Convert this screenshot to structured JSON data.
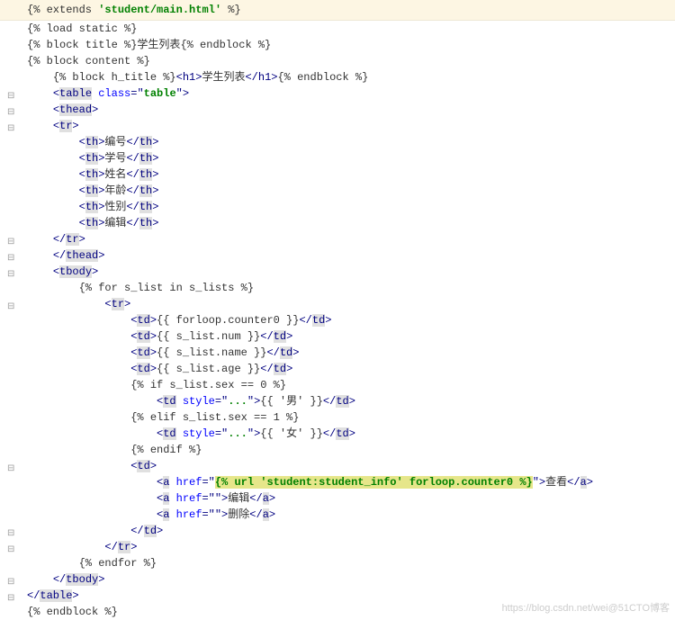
{
  "lines": [
    {
      "indent": 0,
      "type": "header",
      "seg": [
        [
          "tmpl-tag",
          "{% extends "
        ],
        [
          "tmpl-str",
          "'student/main.html'"
        ],
        [
          "tmpl-tag",
          " %}"
        ]
      ]
    },
    {
      "indent": 0,
      "seg": [
        [
          "tmpl-tag",
          "{% load static %}"
        ]
      ]
    },
    {
      "indent": 0,
      "seg": [
        [
          "tmpl-tag",
          "{% block title %}"
        ],
        [
          "text",
          "学生列表"
        ],
        [
          "tmpl-tag",
          "{% endblock %}"
        ]
      ]
    },
    {
      "indent": 0,
      "seg": [
        [
          "tmpl-tag",
          "{% block content %}"
        ]
      ]
    },
    {
      "indent": 1,
      "seg": [
        [
          "tmpl-tag",
          "{% block h_title %}"
        ],
        [
          "tag",
          "<"
        ],
        [
          "tag-name",
          "h1"
        ],
        [
          "tag",
          ">"
        ],
        [
          "text",
          "学生列表"
        ],
        [
          "tag",
          "</"
        ],
        [
          "tag-name",
          "h1"
        ],
        [
          "tag",
          ">"
        ],
        [
          "tmpl-tag",
          "{% endblock %}"
        ]
      ]
    },
    {
      "indent": 1,
      "fold": "-",
      "seg": [
        [
          "tag",
          "<"
        ],
        [
          "tag-name hl-grey",
          "table"
        ],
        [
          "text",
          " "
        ],
        [
          "attr-name",
          "class"
        ],
        [
          "tag",
          "=\""
        ],
        [
          "attr-val",
          "table"
        ],
        [
          "tag",
          "\">"
        ]
      ]
    },
    {
      "indent": 1,
      "fold": "-",
      "seg": [
        [
          "tag",
          "<"
        ],
        [
          "tag-name hl-grey",
          "thead"
        ],
        [
          "tag",
          ">"
        ]
      ]
    },
    {
      "indent": 1,
      "fold": "-",
      "seg": [
        [
          "tag",
          "<"
        ],
        [
          "tag-name hl-grey",
          "tr"
        ],
        [
          "tag",
          ">"
        ]
      ]
    },
    {
      "indent": 2,
      "seg": [
        [
          "tag",
          "<"
        ],
        [
          "tag-name hl-grey",
          "th"
        ],
        [
          "tag",
          ">"
        ],
        [
          "text",
          "编号"
        ],
        [
          "tag",
          "</"
        ],
        [
          "tag-name hl-grey",
          "th"
        ],
        [
          "tag",
          ">"
        ]
      ]
    },
    {
      "indent": 2,
      "seg": [
        [
          "tag",
          "<"
        ],
        [
          "tag-name hl-grey",
          "th"
        ],
        [
          "tag",
          ">"
        ],
        [
          "text",
          "学号"
        ],
        [
          "tag",
          "</"
        ],
        [
          "tag-name hl-grey",
          "th"
        ],
        [
          "tag",
          ">"
        ]
      ]
    },
    {
      "indent": 2,
      "seg": [
        [
          "tag",
          "<"
        ],
        [
          "tag-name hl-grey",
          "th"
        ],
        [
          "tag",
          ">"
        ],
        [
          "text",
          "姓名"
        ],
        [
          "tag",
          "</"
        ],
        [
          "tag-name hl-grey",
          "th"
        ],
        [
          "tag",
          ">"
        ]
      ]
    },
    {
      "indent": 2,
      "seg": [
        [
          "tag",
          "<"
        ],
        [
          "tag-name hl-grey",
          "th"
        ],
        [
          "tag",
          ">"
        ],
        [
          "text",
          "年龄"
        ],
        [
          "tag",
          "</"
        ],
        [
          "tag-name hl-grey",
          "th"
        ],
        [
          "tag",
          ">"
        ]
      ]
    },
    {
      "indent": 2,
      "seg": [
        [
          "tag",
          "<"
        ],
        [
          "tag-name hl-grey",
          "th"
        ],
        [
          "tag",
          ">"
        ],
        [
          "text",
          "性别"
        ],
        [
          "tag",
          "</"
        ],
        [
          "tag-name hl-grey",
          "th"
        ],
        [
          "tag",
          ">"
        ]
      ]
    },
    {
      "indent": 2,
      "seg": [
        [
          "tag",
          "<"
        ],
        [
          "tag-name hl-grey",
          "th"
        ],
        [
          "tag",
          ">"
        ],
        [
          "text",
          "编辑"
        ],
        [
          "tag",
          "</"
        ],
        [
          "tag-name hl-grey",
          "th"
        ],
        [
          "tag",
          ">"
        ]
      ]
    },
    {
      "indent": 1,
      "fold": "-",
      "seg": [
        [
          "tag",
          "</"
        ],
        [
          "tag-name hl-grey",
          "tr"
        ],
        [
          "tag",
          ">"
        ]
      ]
    },
    {
      "indent": 1,
      "fold": "-",
      "seg": [
        [
          "tag",
          "</"
        ],
        [
          "tag-name hl-grey",
          "thead"
        ],
        [
          "tag",
          ">"
        ]
      ]
    },
    {
      "indent": 1,
      "fold": "-",
      "seg": [
        [
          "tag",
          "<"
        ],
        [
          "tag-name hl-grey",
          "tbody"
        ],
        [
          "tag",
          ">"
        ]
      ]
    },
    {
      "indent": 2,
      "seg": [
        [
          "tmpl-tag",
          "{% for s_list in s_lists %}"
        ]
      ]
    },
    {
      "indent": 3,
      "fold": "-",
      "seg": [
        [
          "tag",
          "<"
        ],
        [
          "tag-name hl-grey",
          "tr"
        ],
        [
          "tag",
          ">"
        ]
      ]
    },
    {
      "indent": 4,
      "seg": [
        [
          "tag",
          "<"
        ],
        [
          "tag-name hl-grey",
          "td"
        ],
        [
          "tag",
          ">"
        ],
        [
          "tmpl-var",
          "{{ forloop.counter0 }}"
        ],
        [
          "tag",
          "</"
        ],
        [
          "tag-name hl-grey",
          "td"
        ],
        [
          "tag",
          ">"
        ]
      ]
    },
    {
      "indent": 4,
      "seg": [
        [
          "tag",
          "<"
        ],
        [
          "tag-name hl-grey",
          "td"
        ],
        [
          "tag",
          ">"
        ],
        [
          "tmpl-var",
          "{{ s_list.num }}"
        ],
        [
          "tag",
          "</"
        ],
        [
          "tag-name hl-grey",
          "td"
        ],
        [
          "tag",
          ">"
        ]
      ]
    },
    {
      "indent": 4,
      "seg": [
        [
          "tag",
          "<"
        ],
        [
          "tag-name hl-grey",
          "td"
        ],
        [
          "tag",
          ">"
        ],
        [
          "tmpl-var",
          "{{ s_list.name }}"
        ],
        [
          "tag",
          "</"
        ],
        [
          "tag-name hl-grey",
          "td"
        ],
        [
          "tag",
          ">"
        ]
      ]
    },
    {
      "indent": 4,
      "seg": [
        [
          "tag",
          "<"
        ],
        [
          "tag-name hl-grey",
          "td"
        ],
        [
          "tag",
          ">"
        ],
        [
          "tmpl-var",
          "{{ s_list.age }}"
        ],
        [
          "tag",
          "</"
        ],
        [
          "tag-name hl-grey",
          "td"
        ],
        [
          "tag",
          ">"
        ]
      ]
    },
    {
      "indent": 4,
      "seg": [
        [
          "tmpl-tag",
          "{% if s_list.sex == 0 %}"
        ]
      ]
    },
    {
      "indent": 5,
      "seg": [
        [
          "tag",
          "<"
        ],
        [
          "tag-name hl-grey",
          "td"
        ],
        [
          "text",
          " "
        ],
        [
          "attr-name",
          "style"
        ],
        [
          "tag",
          "=\""
        ],
        [
          "attr-val",
          "..."
        ],
        [
          "tag",
          "\">"
        ],
        [
          "tmpl-var",
          "{{ '男' }}"
        ],
        [
          "tag",
          "</"
        ],
        [
          "tag-name hl-grey",
          "td"
        ],
        [
          "tag",
          ">"
        ]
      ]
    },
    {
      "indent": 4,
      "seg": [
        [
          "tmpl-tag",
          "{% elif s_list.sex == 1 %}"
        ]
      ]
    },
    {
      "indent": 5,
      "seg": [
        [
          "tag",
          "<"
        ],
        [
          "tag-name hl-grey",
          "td"
        ],
        [
          "text",
          " "
        ],
        [
          "attr-name",
          "style"
        ],
        [
          "tag",
          "=\""
        ],
        [
          "attr-val",
          "..."
        ],
        [
          "tag",
          "\">"
        ],
        [
          "tmpl-var",
          "{{ '女' }}"
        ],
        [
          "tag",
          "</"
        ],
        [
          "tag-name hl-grey",
          "td"
        ],
        [
          "tag",
          ">"
        ]
      ]
    },
    {
      "indent": 4,
      "seg": [
        [
          "tmpl-tag",
          "{% endif %}"
        ]
      ]
    },
    {
      "indent": 4,
      "fold": "-",
      "seg": [
        [
          "tag",
          "<"
        ],
        [
          "tag-name hl-grey",
          "td"
        ],
        [
          "tag",
          ">"
        ]
      ]
    },
    {
      "indent": 5,
      "seg": [
        [
          "tag",
          "<"
        ],
        [
          "tag-name hl-grey",
          "a"
        ],
        [
          "text",
          " "
        ],
        [
          "attr-name",
          "href"
        ],
        [
          "tag",
          "=\""
        ],
        [
          "url-str",
          "{% url 'student:student_info' forloop.counter0 %}"
        ],
        [
          "tag",
          "\">"
        ],
        [
          "text",
          "查看"
        ],
        [
          "tag",
          "</"
        ],
        [
          "tag-name hl-grey",
          "a"
        ],
        [
          "tag",
          ">"
        ]
      ]
    },
    {
      "indent": 5,
      "seg": [
        [
          "tag",
          "<"
        ],
        [
          "tag-name hl-grey",
          "a"
        ],
        [
          "text",
          " "
        ],
        [
          "attr-name",
          "href"
        ],
        [
          "tag",
          "=\""
        ],
        [
          "attr-val",
          ""
        ],
        [
          "tag",
          "\">"
        ],
        [
          "text",
          "编辑"
        ],
        [
          "tag",
          "</"
        ],
        [
          "tag-name hl-grey",
          "a"
        ],
        [
          "tag",
          ">"
        ]
      ]
    },
    {
      "indent": 5,
      "seg": [
        [
          "tag",
          "<"
        ],
        [
          "tag-name hl-grey",
          "a"
        ],
        [
          "text",
          " "
        ],
        [
          "attr-name",
          "href"
        ],
        [
          "tag",
          "=\""
        ],
        [
          "attr-val",
          ""
        ],
        [
          "tag",
          "\">"
        ],
        [
          "text",
          "删除"
        ],
        [
          "tag",
          "</"
        ],
        [
          "tag-name hl-grey",
          "a"
        ],
        [
          "tag",
          ">"
        ]
      ]
    },
    {
      "indent": 4,
      "fold": "-",
      "seg": [
        [
          "tag",
          "</"
        ],
        [
          "tag-name hl-grey",
          "td"
        ],
        [
          "tag",
          ">"
        ]
      ]
    },
    {
      "indent": 3,
      "fold": "-",
      "seg": [
        [
          "tag",
          "</"
        ],
        [
          "tag-name hl-grey",
          "tr"
        ],
        [
          "tag",
          ">"
        ]
      ]
    },
    {
      "indent": 2,
      "seg": [
        [
          "tmpl-tag",
          "{% endfor %}"
        ]
      ]
    },
    {
      "indent": 1,
      "fold": "-",
      "seg": [
        [
          "tag",
          "</"
        ],
        [
          "tag-name hl-grey",
          "tbody"
        ],
        [
          "tag",
          ">"
        ]
      ]
    },
    {
      "indent": 0,
      "fold": "-",
      "seg": [
        [
          "tag",
          "</"
        ],
        [
          "tag-name hl-grey",
          "table"
        ],
        [
          "tag",
          ">"
        ]
      ]
    },
    {
      "indent": 0,
      "seg": [
        [
          "tmpl-tag",
          "{% endblock %}"
        ]
      ]
    }
  ],
  "watermark": "https://blog.csdn.net/wei@51CTO博客",
  "indent_str": "    "
}
